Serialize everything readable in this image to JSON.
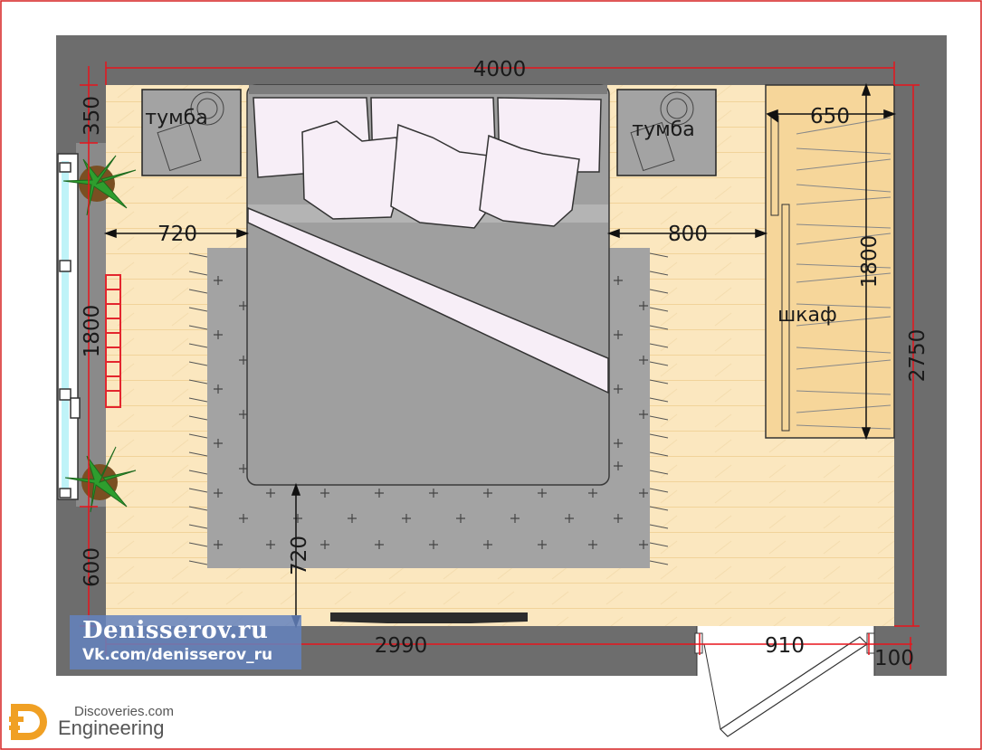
{
  "dimensions": {
    "total_width": "4000",
    "wardrobe_depth": "650",
    "wardrobe_length": "1800",
    "room_depth": "2750",
    "left_clearance": "720",
    "right_clearance": "800",
    "foot_clearance": "720",
    "wall_top_offset": "350",
    "window_width": "1800",
    "wall_bottom_offset": "600",
    "bottom_wall_segment": "2990",
    "door_width": "910",
    "door_offset": "100"
  },
  "labels": {
    "nightstand_left": "тумба",
    "nightstand_right": "тумба",
    "wardrobe": "шкаф"
  },
  "watermark": {
    "site": "Denisserov.ru",
    "vk": "Vk.com/denisserov_ru"
  },
  "brand": {
    "line1": "Discoveries.com",
    "line2": "Engineering"
  },
  "colors": {
    "wall": "#6d6d6d",
    "floor": "#fbe7bf",
    "dimension": "#e8141c",
    "rug": "#a3a3a3",
    "bed": "#9f9f9f",
    "pillow": "#f7eef7",
    "brand_accent": "#f0a024"
  }
}
